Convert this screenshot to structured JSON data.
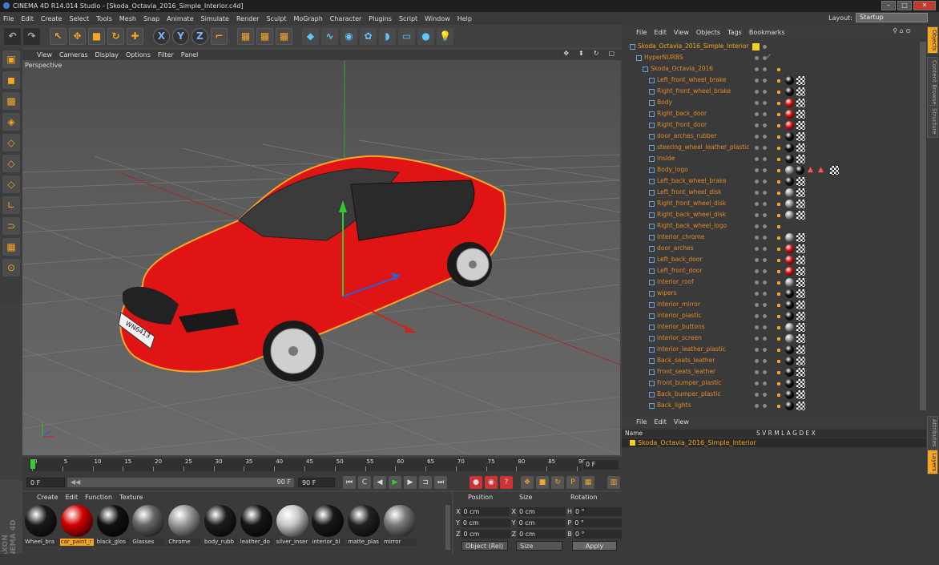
{
  "window": {
    "title": "CINEMA 4D R14.014 Studio - [Skoda_Octavia_2016_Simple_Interior.c4d]"
  },
  "menu": [
    "File",
    "Edit",
    "Create",
    "Select",
    "Tools",
    "Mesh",
    "Snap",
    "Animate",
    "Simulate",
    "Render",
    "Sculpt",
    "MoGraph",
    "Character",
    "Plugins",
    "Script",
    "Window",
    "Help"
  ],
  "layout": {
    "label": "Layout:",
    "value": "Startup"
  },
  "viewport": {
    "menu": [
      "View",
      "Cameras",
      "Display",
      "Options",
      "Filter",
      "Panel"
    ],
    "label": "Perspective"
  },
  "timeline": {
    "ticks": [
      "0",
      "5",
      "10",
      "15",
      "20",
      "25",
      "30",
      "35",
      "40",
      "45",
      "50",
      "55",
      "60",
      "65",
      "70",
      "75",
      "80",
      "85",
      "90"
    ],
    "end_frame": "0 F",
    "current": "0 F",
    "range_start": "0 F",
    "range_end": "90 F",
    "max": "90 F"
  },
  "materials": {
    "menu": [
      "Create",
      "Edit",
      "Function",
      "Texture"
    ],
    "items": [
      {
        "name": "Wheel_bra",
        "color": "#1a1a1a",
        "selected": false
      },
      {
        "name": "car_paint_r",
        "color": "#d40000",
        "selected": true
      },
      {
        "name": "black_glos",
        "color": "#111111",
        "selected": false
      },
      {
        "name": "Glasses",
        "color": "#666666",
        "selected": false
      },
      {
        "name": "Chrome",
        "color": "#9a9a9a",
        "selected": false
      },
      {
        "name": "body_rubb",
        "color": "#1c1c1c",
        "selected": false
      },
      {
        "name": "leather_do",
        "color": "#151515",
        "selected": false
      },
      {
        "name": "silver_inser",
        "color": "#c9c9c9",
        "selected": false
      },
      {
        "name": "interior_bl",
        "color": "#181818",
        "selected": false
      },
      {
        "name": "matte_plas",
        "color": "#222222",
        "selected": false
      },
      {
        "name": "mirror",
        "color": "#7a7a7a",
        "selected": false
      }
    ]
  },
  "coords": {
    "headers": [
      "Position",
      "Size",
      "Rotation"
    ],
    "rows": [
      {
        "axis": "X",
        "pos": "0 cm",
        "size_axis": "X",
        "size": "0 cm",
        "rot_axis": "H",
        "rot": "0 °"
      },
      {
        "axis": "Y",
        "pos": "0 cm",
        "size_axis": "Y",
        "size": "0 cm",
        "rot_axis": "P",
        "rot": "0 °"
      },
      {
        "axis": "Z",
        "pos": "0 cm",
        "size_axis": "Z",
        "size": "0 cm",
        "rot_axis": "B",
        "rot": "0 °"
      }
    ],
    "mode": "Object (Rel)",
    "size_mode": "Size",
    "apply": "Apply"
  },
  "objects": {
    "menu": [
      "File",
      "Edit",
      "View",
      "Objects",
      "Tags",
      "Bookmarks"
    ],
    "items": [
      {
        "name": "Skoda_Octavia_2016_Simple_Interior",
        "indent": 0,
        "tags": "yellow"
      },
      {
        "name": "HyperNURBS",
        "indent": 1,
        "tags": "check"
      },
      {
        "name": "Skoda_Octavia_2016",
        "indent": 2,
        "tags": ""
      },
      {
        "name": "Left_front_wheel_brake",
        "indent": 3,
        "tags": "black"
      },
      {
        "name": "Right_front_wheel_brake",
        "indent": 3,
        "tags": "black"
      },
      {
        "name": "Body",
        "indent": 3,
        "tags": "red"
      },
      {
        "name": "Right_back_door",
        "indent": 3,
        "tags": "red"
      },
      {
        "name": "Right_front_door",
        "indent": 3,
        "tags": "red"
      },
      {
        "name": "door_arches_rubber",
        "indent": 3,
        "tags": "black"
      },
      {
        "name": "steering_wheel_leather_plastic",
        "indent": 3,
        "tags": "black"
      },
      {
        "name": "Inside",
        "indent": 3,
        "tags": "black"
      },
      {
        "name": "Body_logo",
        "indent": 3,
        "tags": "logo"
      },
      {
        "name": "Left_back_wheel_brake",
        "indent": 3,
        "tags": "black"
      },
      {
        "name": "Left_front_wheel_disk",
        "indent": 3,
        "tags": "grey"
      },
      {
        "name": "Right_front_wheel_disk",
        "indent": 3,
        "tags": "grey"
      },
      {
        "name": "Right_back_wheel_disk",
        "indent": 3,
        "tags": "grey"
      },
      {
        "name": "Right_back_wheel_logo",
        "indent": 3,
        "tags": ""
      },
      {
        "name": "Interior_chrome",
        "indent": 3,
        "tags": "grey"
      },
      {
        "name": "door_arches",
        "indent": 3,
        "tags": "red"
      },
      {
        "name": "Left_back_door",
        "indent": 3,
        "tags": "red"
      },
      {
        "name": "Left_front_door",
        "indent": 3,
        "tags": "red"
      },
      {
        "name": "interior_roof",
        "indent": 3,
        "tags": "grey"
      },
      {
        "name": "wipers",
        "indent": 3,
        "tags": "black"
      },
      {
        "name": "interior_mirror",
        "indent": 3,
        "tags": "black"
      },
      {
        "name": "interior_plastic",
        "indent": 3,
        "tags": "black"
      },
      {
        "name": "interior_buttons",
        "indent": 3,
        "tags": "grey"
      },
      {
        "name": "interior_screen",
        "indent": 3,
        "tags": "grey"
      },
      {
        "name": "interior_leather_plastic",
        "indent": 3,
        "tags": "black"
      },
      {
        "name": "Back_seats_leather",
        "indent": 3,
        "tags": "black"
      },
      {
        "name": "Front_seats_leather",
        "indent": 3,
        "tags": "black"
      },
      {
        "name": "Front_bumper_plastic",
        "indent": 3,
        "tags": "black"
      },
      {
        "name": "Back_bumper_plastic",
        "indent": 3,
        "tags": "black"
      },
      {
        "name": "Back_lights",
        "indent": 3,
        "tags": "black"
      }
    ]
  },
  "attributes": {
    "menu": [
      "File",
      "Edit",
      "View"
    ],
    "header_name": "Name",
    "header_cols": "S V R M L A G D E X",
    "row_name": "Skoda_Octavia_2016_Simple_Interior"
  },
  "side_tabs": [
    "Objects",
    "Content Browser",
    "Structure",
    "Attributes",
    "Layers"
  ],
  "brand": "MAXON CINEMA 4D",
  "license_plate": "WN6413",
  "colors": {
    "accent": "#f5a623",
    "car": "#e01010"
  }
}
